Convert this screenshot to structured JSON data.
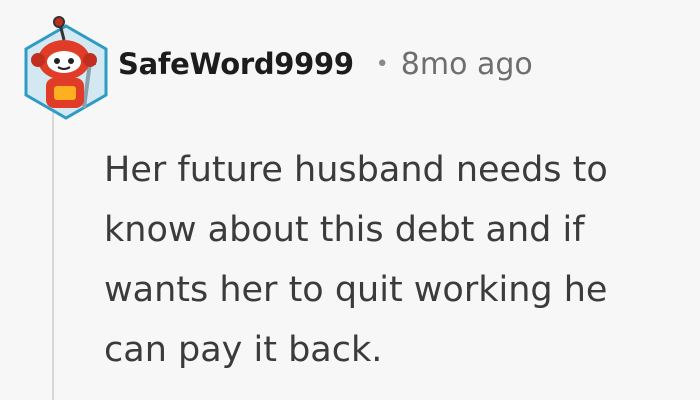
{
  "comment": {
    "username": "SafeWord9999",
    "separator": "•",
    "timestamp": "8mo ago",
    "body_lines": [
      "Her future husband needs to",
      "know about this debt and if",
      "wants her to quit working he",
      "can pay it back."
    ]
  },
  "avatar": {
    "icon": "snoo-robot-avatar-icon",
    "hex_fill": "#d4e8f2",
    "hex_border": "#2d9bc4",
    "character_color": "#e03c28"
  },
  "colors": {
    "background": "#f8f7f7",
    "thread_line": "#d9d7d7",
    "username": "#1c1c1c",
    "meta": "#6e6e6e",
    "body": "#3b3b3b"
  }
}
